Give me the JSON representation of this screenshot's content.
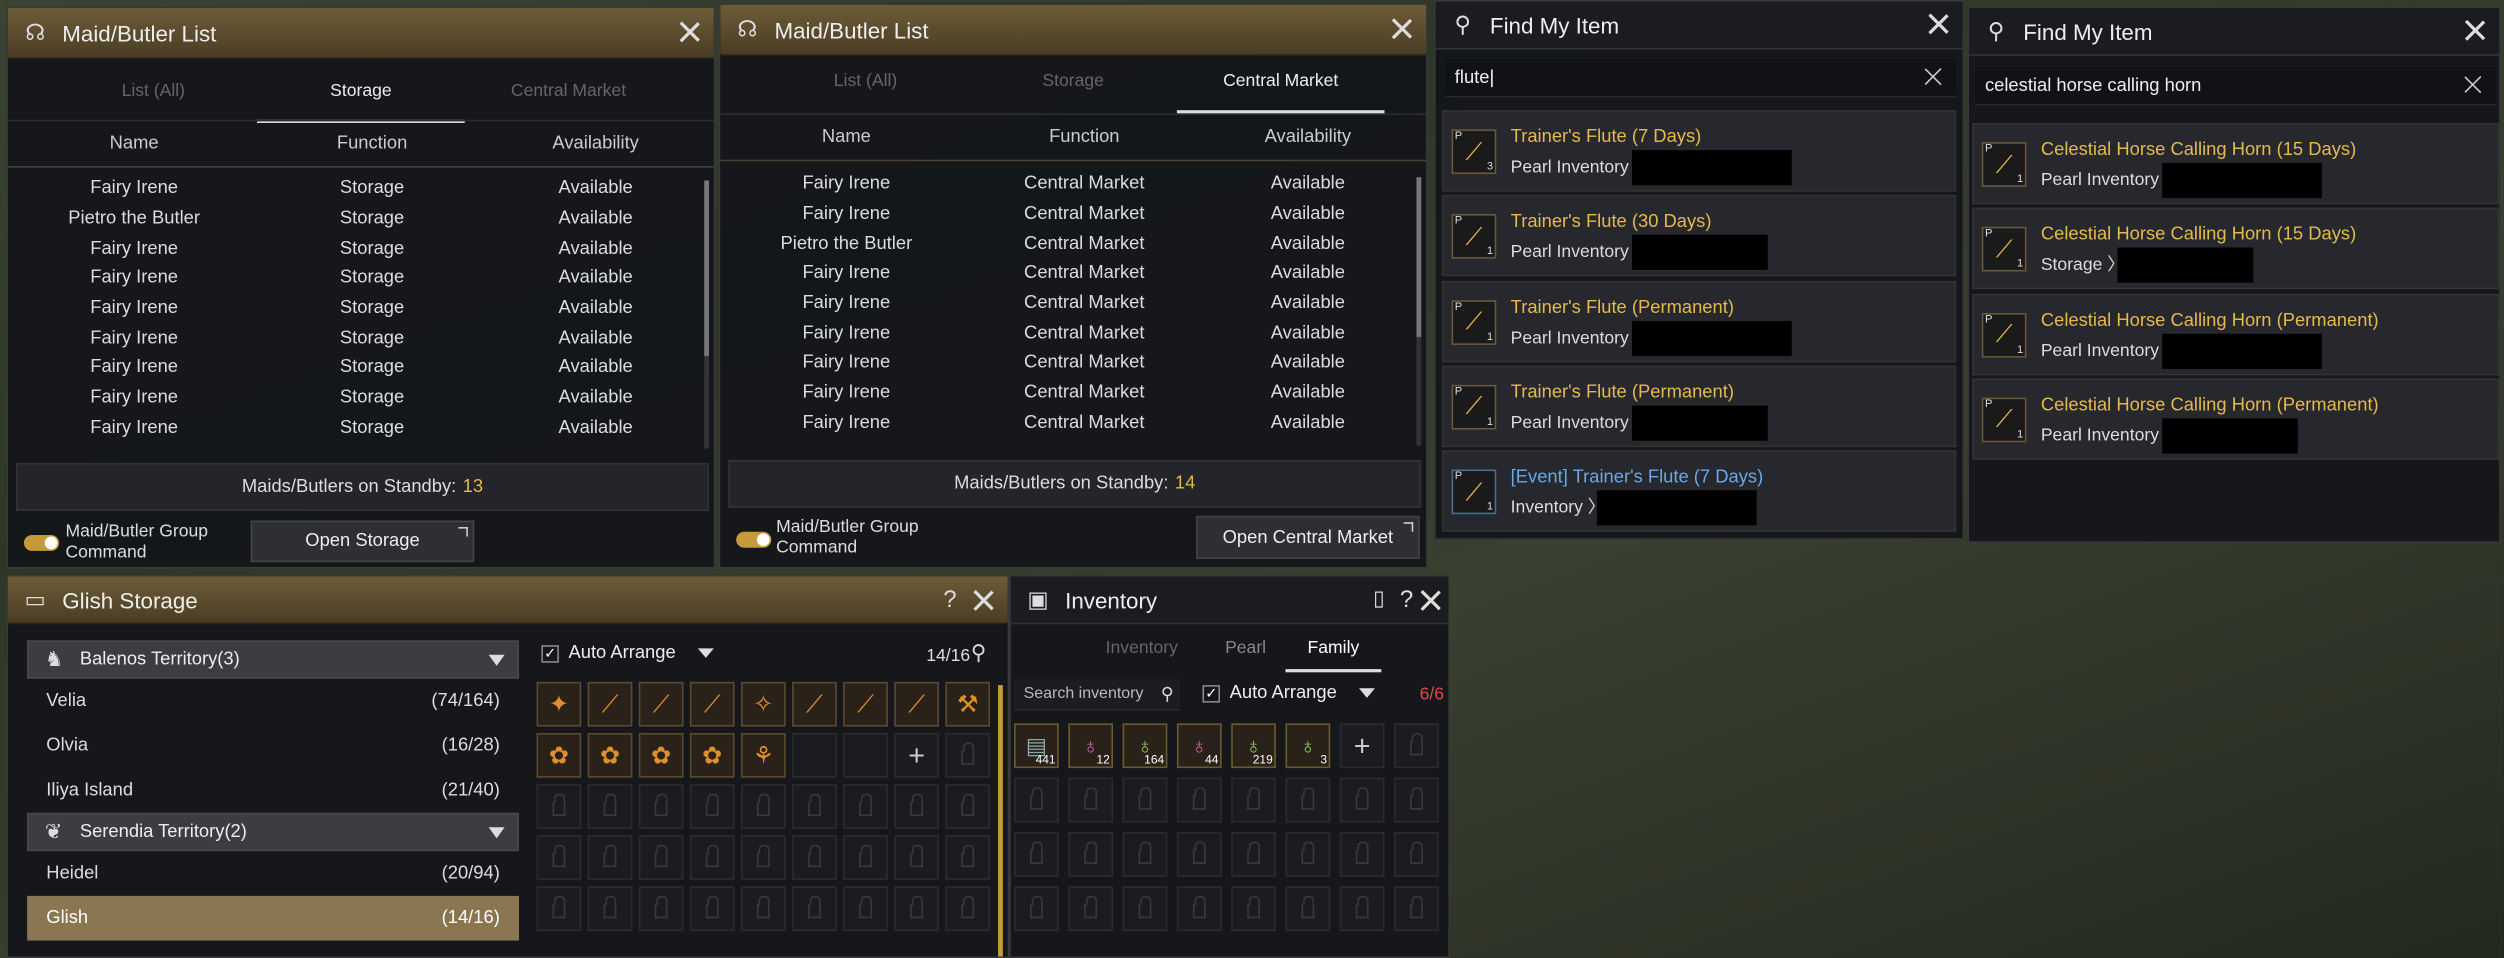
{
  "maid1": {
    "title": "Maid/Butler List",
    "tabs": [
      "List (All)",
      "Storage",
      "Central Market"
    ],
    "columns": [
      "Name",
      "Function",
      "Availability"
    ],
    "rows": [
      [
        "Fairy Irene",
        "Storage",
        "Available"
      ],
      [
        "Pietro the Butler",
        "Storage",
        "Available"
      ],
      [
        "Fairy Irene",
        "Storage",
        "Available"
      ],
      [
        "Fairy Irene",
        "Storage",
        "Available"
      ],
      [
        "Fairy Irene",
        "Storage",
        "Available"
      ],
      [
        "Fairy Irene",
        "Storage",
        "Available"
      ],
      [
        "Fairy Irene",
        "Storage",
        "Available"
      ],
      [
        "Fairy Irene",
        "Storage",
        "Available"
      ],
      [
        "Fairy Irene",
        "Storage",
        "Available"
      ]
    ],
    "standby_label": "Maids/Butlers on Standby:",
    "standby_count": "13",
    "group_label": "Maid/Butler Group Command",
    "open_button": "Open Storage"
  },
  "maid2": {
    "title": "Maid/Butler List",
    "tabs": [
      "List (All)",
      "Storage",
      "Central Market"
    ],
    "columns": [
      "Name",
      "Function",
      "Availability"
    ],
    "rows": [
      [
        "Fairy Irene",
        "Central Market",
        "Available"
      ],
      [
        "Fairy Irene",
        "Central Market",
        "Available"
      ],
      [
        "Pietro the Butler",
        "Central Market",
        "Available"
      ],
      [
        "Fairy Irene",
        "Central Market",
        "Available"
      ],
      [
        "Fairy Irene",
        "Central Market",
        "Available"
      ],
      [
        "Fairy Irene",
        "Central Market",
        "Available"
      ],
      [
        "Fairy Irene",
        "Central Market",
        "Available"
      ],
      [
        "Fairy Irene",
        "Central Market",
        "Available"
      ],
      [
        "Fairy Irene",
        "Central Market",
        "Available"
      ]
    ],
    "standby_label": "Maids/Butlers on Standby:",
    "standby_count": "14",
    "group_label": "Maid/Butler Group Command",
    "open_button": "Open Central Market"
  },
  "find1": {
    "title": "Find My Item",
    "query": "flute",
    "results": [
      {
        "name": "Trainer's Flute (7 Days)",
        "location": "Pearl Inventory",
        "qty": "3"
      },
      {
        "name": "Trainer's Flute (30 Days)",
        "location": "Pearl Inventory",
        "qty": "1"
      },
      {
        "name": "Trainer's Flute (Permanent)",
        "location": "Pearl Inventory",
        "qty": "1"
      },
      {
        "name": "Trainer's Flute (Permanent)",
        "location": "Pearl Inventory",
        "qty": "1"
      },
      {
        "name": "[Event] Trainer's Flute (7 Days)",
        "location": "Inventory",
        "qty": "1"
      }
    ]
  },
  "find2": {
    "title": "Find My Item",
    "query": "celestial horse calling horn",
    "results": [
      {
        "name": "Celestial Horse Calling Horn (15 Days)",
        "location": "Pearl Inventory",
        "qty": "1"
      },
      {
        "name": "Celestial Horse Calling Horn (15 Days)",
        "location": "Storage",
        "qty": "1"
      },
      {
        "name": "Celestial Horse Calling Horn (Permanent)",
        "location": "Pearl Inventory",
        "qty": "1"
      },
      {
        "name": "Celestial Horse Calling Horn (Permanent)",
        "location": "Pearl Inventory",
        "qty": "1"
      }
    ]
  },
  "storage": {
    "title": "Glish Storage",
    "territories": [
      {
        "name": "Balenos Territory(3)",
        "towns": [
          {
            "name": "Velia",
            "count": "(74/164)"
          },
          {
            "name": "Olvia",
            "count": "(16/28)"
          },
          {
            "name": "Iliya Island",
            "count": "(21/40)"
          }
        ]
      },
      {
        "name": "Serendia Territory(2)",
        "towns": [
          {
            "name": "Heidel",
            "count": "(20/94)"
          },
          {
            "name": "Glish",
            "count": "(14/16)"
          }
        ]
      }
    ],
    "auto_arrange": "Auto Arrange",
    "capacity": "14/16"
  },
  "inventory": {
    "title": "Inventory",
    "tabs": [
      "Inventory",
      "Pearl",
      "Family"
    ],
    "search_placeholder": "Search inventory",
    "auto_arrange": "Auto Arrange",
    "slots": "6/6",
    "item_qty": [
      "441",
      "12",
      "164",
      "44",
      "219",
      "3"
    ]
  },
  "colors": {
    "accent": "#e6b94a",
    "blue_item": "#6aa8e8",
    "selected_town": "#8a7650"
  }
}
